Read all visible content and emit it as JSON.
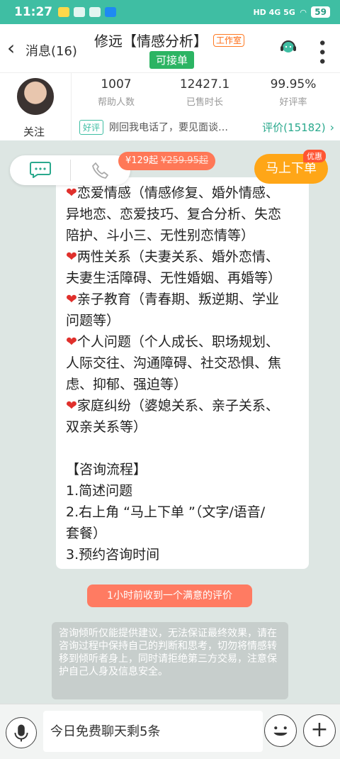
{
  "status_bar": {
    "time": "11:27",
    "network": "HD 4G 5G",
    "battery": "59"
  },
  "header": {
    "back_label": "消息(16)",
    "title": "修远【情感分析】",
    "studio_tag": "工作室",
    "status": "可接单"
  },
  "profile": {
    "follow_label": "关注",
    "stats": [
      {
        "value": "1007",
        "label": "帮助人数"
      },
      {
        "value": "12427.1",
        "label": "已售时长"
      },
      {
        "value": "99.95%",
        "label": "好评率"
      }
    ],
    "review_tag": "好评",
    "review_text": "刚回我电话了，要见面谈…",
    "review_count": "评价(15182)"
  },
  "actions": {
    "price": "¥129起",
    "original_price": "¥259.95起",
    "order_button": "马上下单",
    "discount_badge": "优惠"
  },
  "message": {
    "lines": [
      "❤恋爱情感（情感修复、婚外情感、",
      "异地恋、恋爱技巧、复合分析、失恋",
      "陪护、斗小三、无性别恋情等）",
      "❤两性关系（夫妻关系、婚外恋情、",
      "夫妻生活障碍、无性婚姻、再婚等）",
      "❤亲子教育（青春期、叛逆期、学业",
      "问题等）",
      "❤个人问题（个人成长、职场规划、",
      "人际交往、沟通障碍、社交恐惧、焦",
      "虑、抑郁、强迫等）",
      "❤家庭纠纷（婆媳关系、亲子关系、",
      "双亲关系等）",
      "",
      "【咨询流程】",
      "1.简述问题",
      "2.右上角 “马上下单 ”（文字/语音/",
      "套餐）",
      "3.预约咨询时间"
    ]
  },
  "notices": {
    "review_notice": "1小时前收到一个满意的评价",
    "disclaimer": "咨询倾听仅能提供建议，无法保证最终效果，请在咨询过程中保持自己的判断和思考，切勿将情感转移到倾听者身上，同时请拒绝第三方交易，注意保护自己人身及信息安全。"
  },
  "input": {
    "placeholder": "今日免费聊天剩5条"
  },
  "colors": {
    "brand": "#3fbea3",
    "order": "#ffa617",
    "accent_red": "#ff7b62"
  }
}
